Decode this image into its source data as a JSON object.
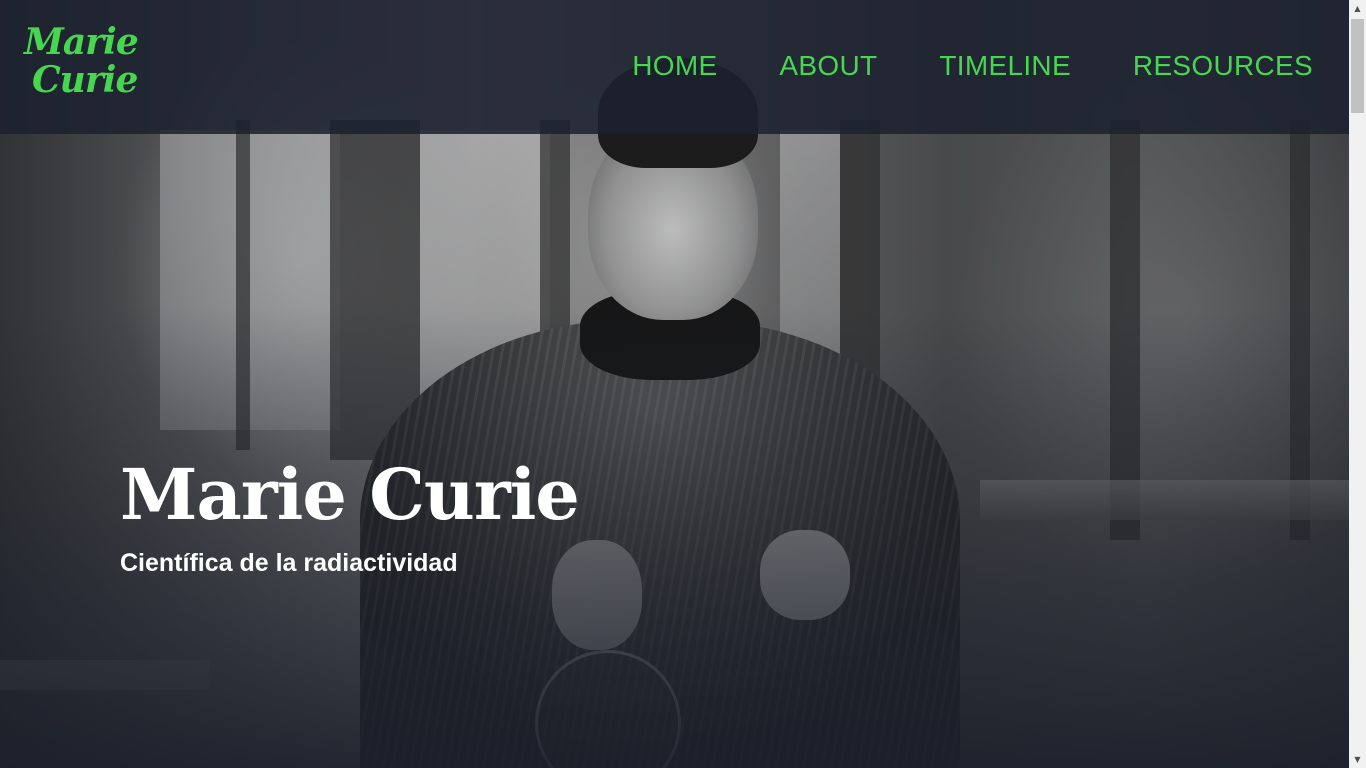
{
  "logo": {
    "line1": "Marie",
    "line2": "Curie"
  },
  "nav": {
    "items": [
      {
        "label": "HOME"
      },
      {
        "label": "ABOUT"
      },
      {
        "label": "TIMELINE"
      },
      {
        "label": "RESOURCES"
      }
    ]
  },
  "hero": {
    "title": "Marie Curie",
    "subtitle": "Científica de la radiactividad"
  },
  "scrollbar": {
    "up_icon": "triangle-up-icon",
    "down_icon": "triangle-down-icon"
  },
  "colors": {
    "accent": "#46d64f",
    "header_bg": "#1b212e",
    "hero_text": "#ffffff"
  }
}
